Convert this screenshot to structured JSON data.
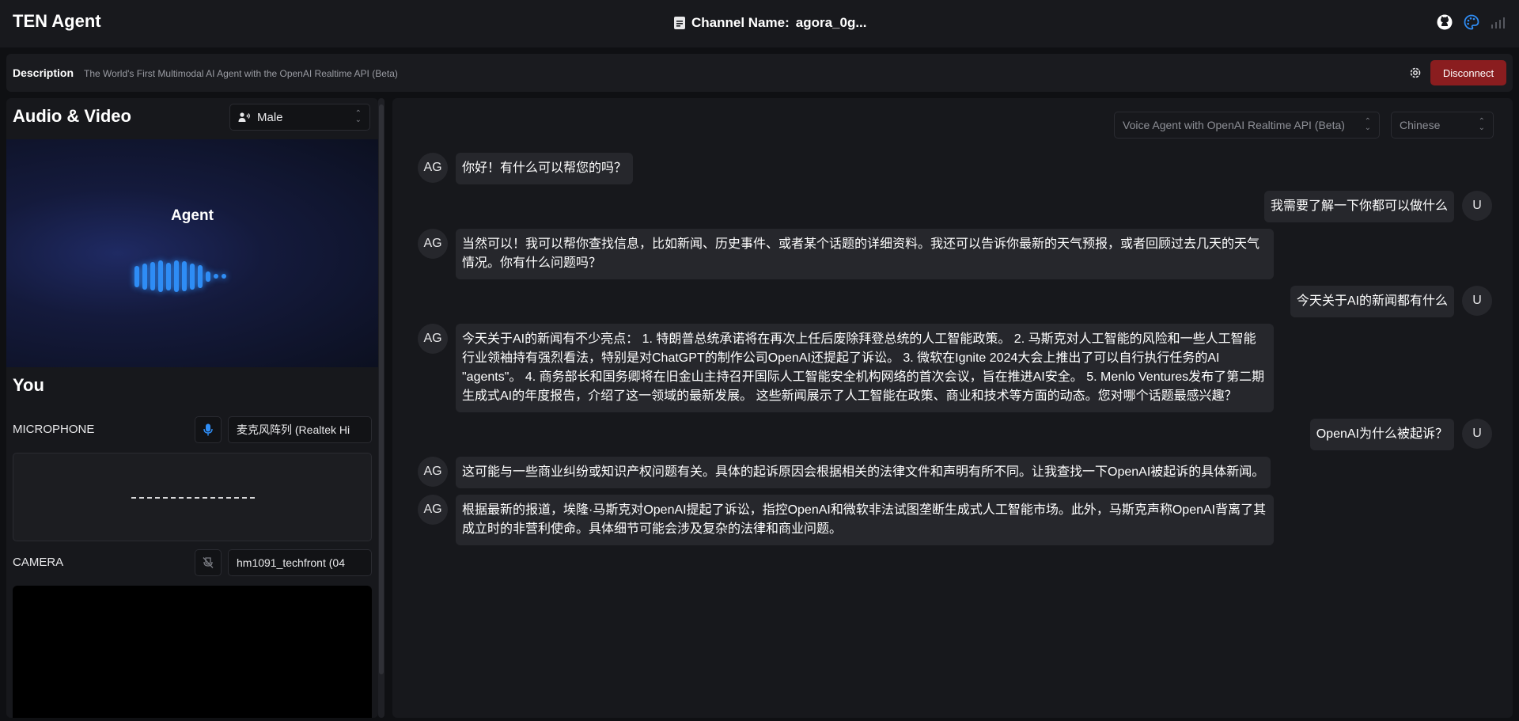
{
  "header": {
    "app_title": "TEN Agent",
    "channel_label": "Channel Name:",
    "channel_value": "agora_0g..."
  },
  "description": {
    "label": "Description",
    "text": "The World's First Multimodal AI Agent with the OpenAI Realtime API (Beta)",
    "disconnect_label": "Disconnect"
  },
  "audio_video": {
    "title": "Audio & Video",
    "voice_select": "Male",
    "agent_label": "Agent",
    "bar_heights": [
      0.62,
      0.74,
      0.82,
      0.92,
      0.8,
      0.92,
      0.86,
      0.74,
      0.66,
      0.3,
      0.14,
      0.14
    ]
  },
  "you": {
    "title": "You",
    "microphone_label": "MICROPHONE",
    "microphone_device": "麦克风阵列 (Realtek Hi",
    "camera_label": "CAMERA",
    "camera_device": "hm1091_techfront (04"
  },
  "chat": {
    "graph_select": "Voice Agent with OpenAI Realtime API (Beta)",
    "language_select": "Chinese",
    "messages": [
      {
        "role": "agent",
        "avatar": "AG",
        "text": "你好！有什么可以帮您的吗？"
      },
      {
        "role": "user",
        "avatar": "U",
        "text": "我需要了解一下你都可以做什么"
      },
      {
        "role": "agent",
        "avatar": "AG",
        "text": "当然可以！我可以帮你查找信息，比如新闻、历史事件、或者某个话题的详细资料。我还可以告诉你最新的天气预报，或者回顾过去几天的天气情况。你有什么问题吗？"
      },
      {
        "role": "user",
        "avatar": "U",
        "text": "今天关于AI的新闻都有什么"
      },
      {
        "role": "agent",
        "avatar": "AG",
        "text": "今天关于AI的新闻有不少亮点： 1. 特朗普总统承诺将在再次上任后废除拜登总统的人工智能政策。 2. 马斯克对人工智能的风险和一些人工智能行业领袖持有强烈看法，特别是对ChatGPT的制作公司OpenAI还提起了诉讼。 3. 微软在Ignite 2024大会上推出了可以自行执行任务的AI \"agents\"。 4. 商务部长和国务卿将在旧金山主持召开国际人工智能安全机构网络的首次会议，旨在推进AI安全。 5. Menlo Ventures发布了第二期生成式AI的年度报告，介绍了这一领域的最新发展。 这些新闻展示了人工智能在政策、商业和技术等方面的动态。您对哪个话题最感兴趣？"
      },
      {
        "role": "user",
        "avatar": "U",
        "text": "OpenAI为什么被起诉？"
      },
      {
        "role": "agent",
        "avatar": "AG",
        "text": "这可能与一些商业纠纷或知识产权问题有关。具体的起诉原因会根据相关的法律文件和声明有所不同。让我查找一下OpenAI被起诉的具体新闻。"
      },
      {
        "role": "agent",
        "avatar": "AG",
        "text": "根据最新的报道，埃隆·马斯克对OpenAI提起了诉讼，指控OpenAI和微软非法试图垄断生成式人工智能市场。此外，马斯克声称OpenAI背离了其成立时的非营利使命。具体细节可能会涉及复杂的法律和商业问题。"
      }
    ]
  },
  "colors": {
    "accent_blue": "#2f8df5",
    "disconnect_red": "#8a1d1f",
    "bubble": "#26272c",
    "panel": "#17181c"
  }
}
